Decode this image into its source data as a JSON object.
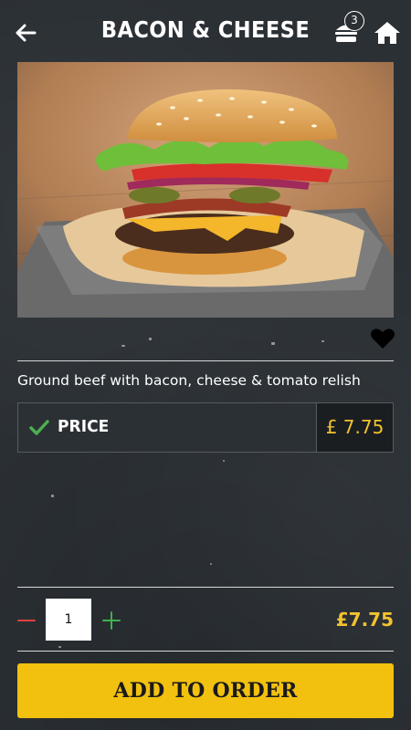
{
  "header": {
    "title": "BACON & CHEESE",
    "cart_count": "3",
    "back_icon": "arrow-left-icon",
    "cart_icon": "burger-icon",
    "home_icon": "home-icon"
  },
  "product": {
    "image_subject": "burger",
    "description": "Ground beef with bacon, cheese & tomato relish",
    "favorite_icon": "heart-icon"
  },
  "price_option": {
    "label": "PRICE",
    "value": "£ 7.75",
    "selected_icon": "check-icon"
  },
  "quantity": {
    "value": "1",
    "minus_icon": "minus-icon",
    "plus_icon": "plus-icon"
  },
  "total": "£7.75",
  "add_button_label": "ADD TO ORDER",
  "colors": {
    "background": "#2b3035",
    "accent": "#f2c10f",
    "price_text": "#f2c230",
    "check": "#4caf50",
    "minus": "#e0413a",
    "plus": "#3fb24b"
  }
}
